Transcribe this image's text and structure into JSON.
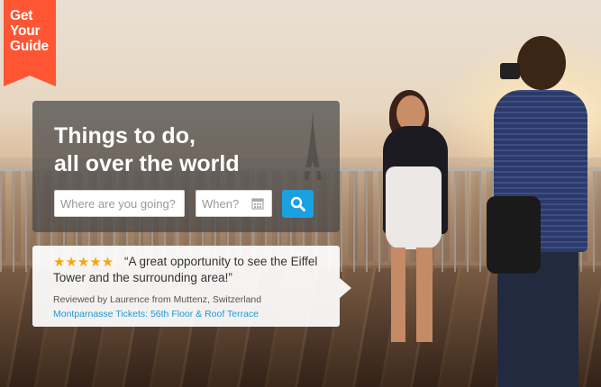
{
  "brand": {
    "logo_line1": "Get",
    "logo_line2": "Your",
    "logo_line3": "Guide",
    "color": "#ff5533"
  },
  "hero": {
    "headline_line1": "Things to do,",
    "headline_line2": "all over the world"
  },
  "search": {
    "where_placeholder": "Where are you going?",
    "when_placeholder": "When?",
    "button_icon": "search-icon",
    "button_color": "#1ba0e2"
  },
  "review": {
    "stars": "★★★★★",
    "rating": 5,
    "quote": "“A great opportunity to see the Eiffel Tower and the surrounding area!”",
    "reviewer": "Reviewed by Laurence from Muttenz, Switzerland",
    "tour_link": "Montparnasse Tickets: 56th Floor & Roof Terrace"
  }
}
